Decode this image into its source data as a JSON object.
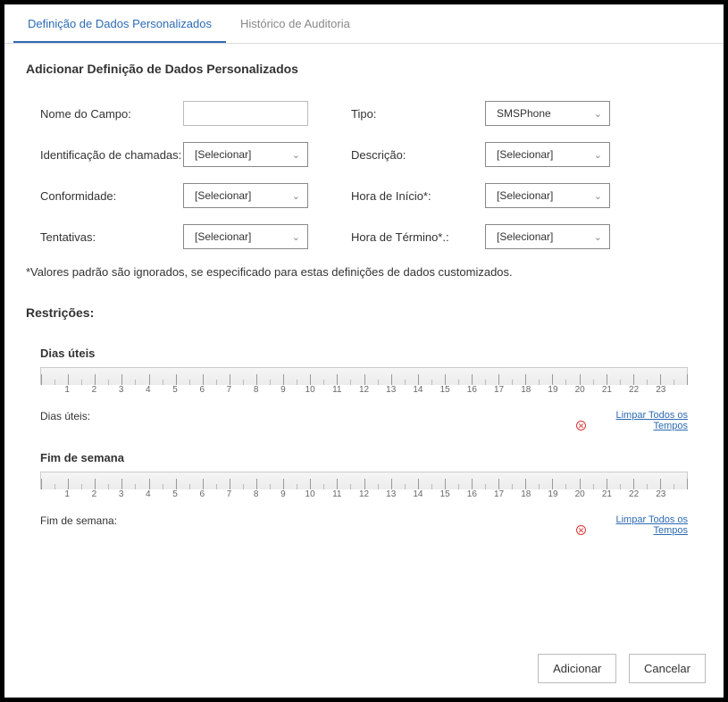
{
  "tabs": {
    "custom_data": "Definição de Dados Personalizados",
    "audit": "Histórico de Auditoria"
  },
  "title": "Adicionar Definição de Dados Personalizados",
  "fields": {
    "name_label": "Nome do Campo:",
    "name_value": "",
    "type_label": "Tipo:",
    "type_value": "SMSPhone",
    "caller_id_label": "Identificação de chamadas:",
    "description_label": "Descrição:",
    "compliance_label": "Conformidade:",
    "start_time_label": "Hora de Início*:",
    "attempts_label": "Tentativas:",
    "end_time_label": "Hora de Término*.:",
    "select_placeholder": "[Selecionar]"
  },
  "note": "*Valores padrão são ignorados, se especificado para estas definições de dados customizados.",
  "restrictions": {
    "title": "Restrições:",
    "weekdays_title": "Dias úteis",
    "weekdays_label": "Dias úteis:",
    "weekend_title": "Fim de semana",
    "weekend_label": "Fim de semana:",
    "clear_link": "Limpar Todos os Tempos",
    "hours": [
      "1",
      "2",
      "3",
      "4",
      "5",
      "6",
      "7",
      "8",
      "9",
      "10",
      "11",
      "12",
      "13",
      "14",
      "15",
      "16",
      "17",
      "18",
      "19",
      "20",
      "21",
      "22",
      "23"
    ]
  },
  "buttons": {
    "add": "Adicionar",
    "cancel": "Cancelar"
  }
}
